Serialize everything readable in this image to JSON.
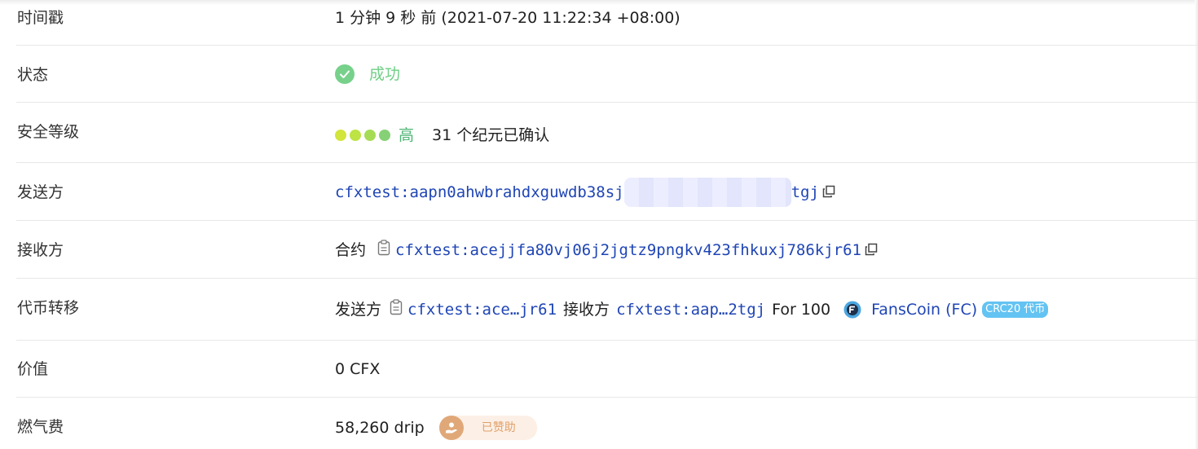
{
  "rows": {
    "timestamp": {
      "label": "时间戳",
      "value": "1 分钟 9 秒 前 (2021-07-20 11:22:34 +08:00)"
    },
    "status": {
      "label": "状态",
      "value": "成功"
    },
    "security": {
      "label": "安全等级",
      "level": "高",
      "confirm": "31 个纪元已确认",
      "dot_colors": [
        "#d1e53a",
        "#bde344",
        "#a6dc55",
        "#86d176"
      ]
    },
    "from": {
      "label": "发送方",
      "address_start": "cfxtest:aapn0ahwbrahdxguwdb38sj",
      "address_end": "tgj"
    },
    "to": {
      "label": "接收方",
      "prefix": "合约",
      "address": "cfxtest:acejjfa80vj06j2jgtz9pngkv423fhkuxj786kjr61"
    },
    "token_transfer": {
      "label": "代币转移",
      "from_label": "发送方",
      "from_addr": "cfxtest:ace…jr61",
      "to_label": "接收方",
      "to_addr": "cfxtest:aap…2tgj",
      "for_text": "For 100",
      "token_name": "FansCoin (FC)",
      "token_badge": "CRC20 代币"
    },
    "value": {
      "label": "价值",
      "value": "0 CFX"
    },
    "gas": {
      "label": "燃气费",
      "value": "58,260 drip",
      "sponsor": "已赞助"
    }
  },
  "colors": {
    "link": "#1f45b5",
    "success": "#77d18b",
    "success_text": "#6fcf86",
    "level_text": "#4cb574"
  }
}
